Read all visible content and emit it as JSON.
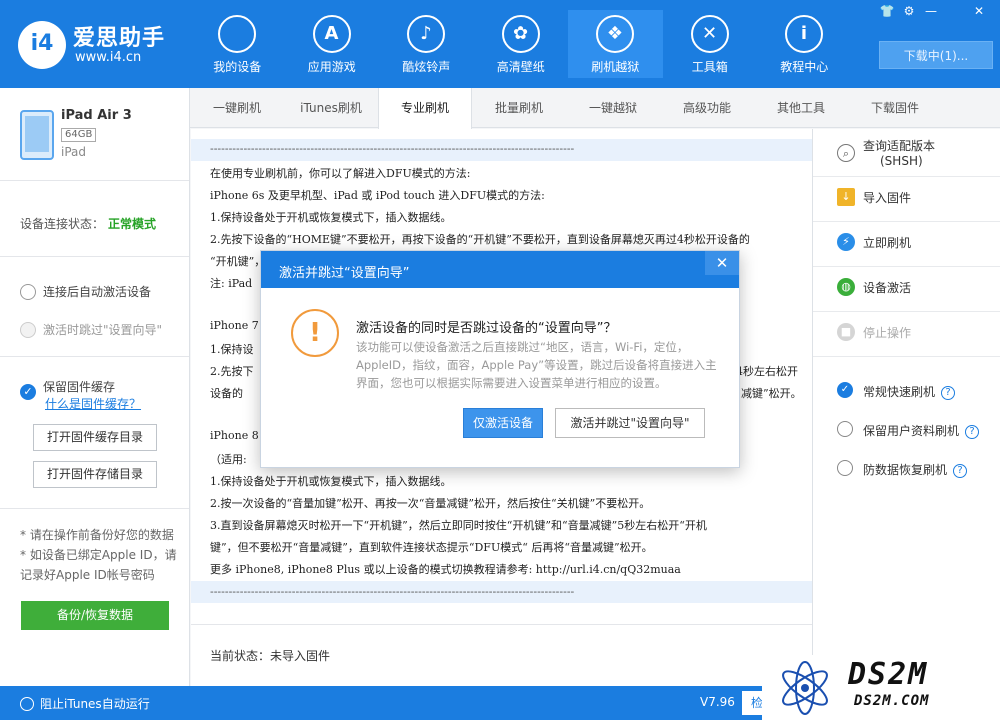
{
  "app": {
    "logo_badge": "i4",
    "logo_name": "爱思助手",
    "logo_url": "www.i4.cn",
    "download_label": "下载中(1)..."
  },
  "nav": [
    {
      "label": "我的设备",
      "icon": ""
    },
    {
      "label": "应用游戏",
      "icon": "A"
    },
    {
      "label": "酷炫铃声",
      "icon": "♪"
    },
    {
      "label": "高清壁纸",
      "icon": "✿"
    },
    {
      "label": "刷机越狱",
      "icon": "❖"
    },
    {
      "label": "工具箱",
      "icon": "✕"
    },
    {
      "label": "教程中心",
      "icon": "i"
    }
  ],
  "window_controls": [
    "👕",
    "⚙",
    "—",
    "✕"
  ],
  "device": {
    "name": "iPad Air 3",
    "capacity": "64GB",
    "type": "iPad",
    "conn_label": "设备连接状态：",
    "conn_value": "正常模式"
  },
  "sidebar": {
    "opt_auto_activate": "连接后自动激活设备",
    "opt_skip_wizard": "激活时跳过\"设置向导\"",
    "opt_keep_cache": "保留固件缓存",
    "link_what_cache": "什么是固件缓存？",
    "btn_open_cache": "打开固件缓存目录",
    "btn_open_store": "打开固件存储目录",
    "note1": "* 请在操作前备份好您的数据",
    "note2": "* 如设备已绑定Apple ID，请记录好Apple ID帐号密码",
    "backup_btn": "备份/恢复数据"
  },
  "tabs": [
    "一键刷机",
    "iTunes刷机",
    "专业刷机",
    "批量刷机",
    "一键越狱",
    "高级功能",
    "其他工具",
    "下载固件"
  ],
  "content": {
    "dashes": "--------------------------------------------------------------------------------------------------",
    "lines": [
      "在使用专业刷机前，你可以了解进入DFU模式的方法:",
      "iPhone 6s 及更早机型、iPad 或 iPod touch 进入DFU模式的方法:",
      "1.保持设备处于开机或恢复模式下，插入数据线。",
      "2.先按下设备的“HOME键”不要松开，再按下设备的“开机键”不要松开，直到设备屏幕熄灭再过4秒松开设备的",
      "  “开机键”，",
      "注: iPad",
      "",
      "iPhone 7",
      "1.保持设",
      "2.先按下",
      "  设备的",
      "",
      "iPhone 8",
      "（适用:",
      "1.保持设备处于开机或恢复模式下，插入数据线。",
      "2.按一次设备的“音量加键”松开、再按一次“音量减键”松开，然后按住“关机键”不要松开。",
      "3.直到设备屏幕熄灭时松开一下“开机键”，然后立即同时按住“开机键”和“音量减键”5秒左右松开“开机",
      "  键”，但不要松开“音量减键”，直到软件连接状态提示“DFU模式“ 后再将“音量减键”松开。",
      "更多 iPhone8, iPhone8 Plus 或以上设备的模式切换教程请参考: http://url.i4.cn/qQ32muaa"
    ],
    "right_frag1": "4秒左右松开",
    "right_frag2": "减键”松开。",
    "status": "当前状态：未导入固件"
  },
  "rpanel": {
    "query_l1": "查询适配版本",
    "query_l2": "(SHSH)",
    "import": "导入固件",
    "flash_now": "立即刷机",
    "activate": "设备激活",
    "stop": "停止操作",
    "opt_quick": "常规快速刷机",
    "opt_keep_data": "保留用户资料刷机",
    "opt_anti_recover": "防数据恢复刷机",
    "help": "?"
  },
  "dialog": {
    "title": "激活并跳过“设置向导”",
    "close": "✕",
    "icon": "!",
    "question": "激活设备的同时是否跳过设备的“设置向导”？",
    "desc": "该功能可以使设备激活之后直接跳过“地区，语言，Wi-Fi，定位，AppleID，指纹，面容，Apple Pay”等设置，跳过后设备将直接进入主界面，您也可以根据实际需要进入设置菜单进行相应的设置。",
    "btn_activate_only": "仅激活设备",
    "btn_activate_skip": "激活并跳过\"设置向导\""
  },
  "bottom": {
    "block_itunes": "阻止iTunes自动运行",
    "version": "V7.96",
    "update": "检"
  },
  "watermark": {
    "text": "DS2M",
    "sub": "DS2M.COM"
  }
}
